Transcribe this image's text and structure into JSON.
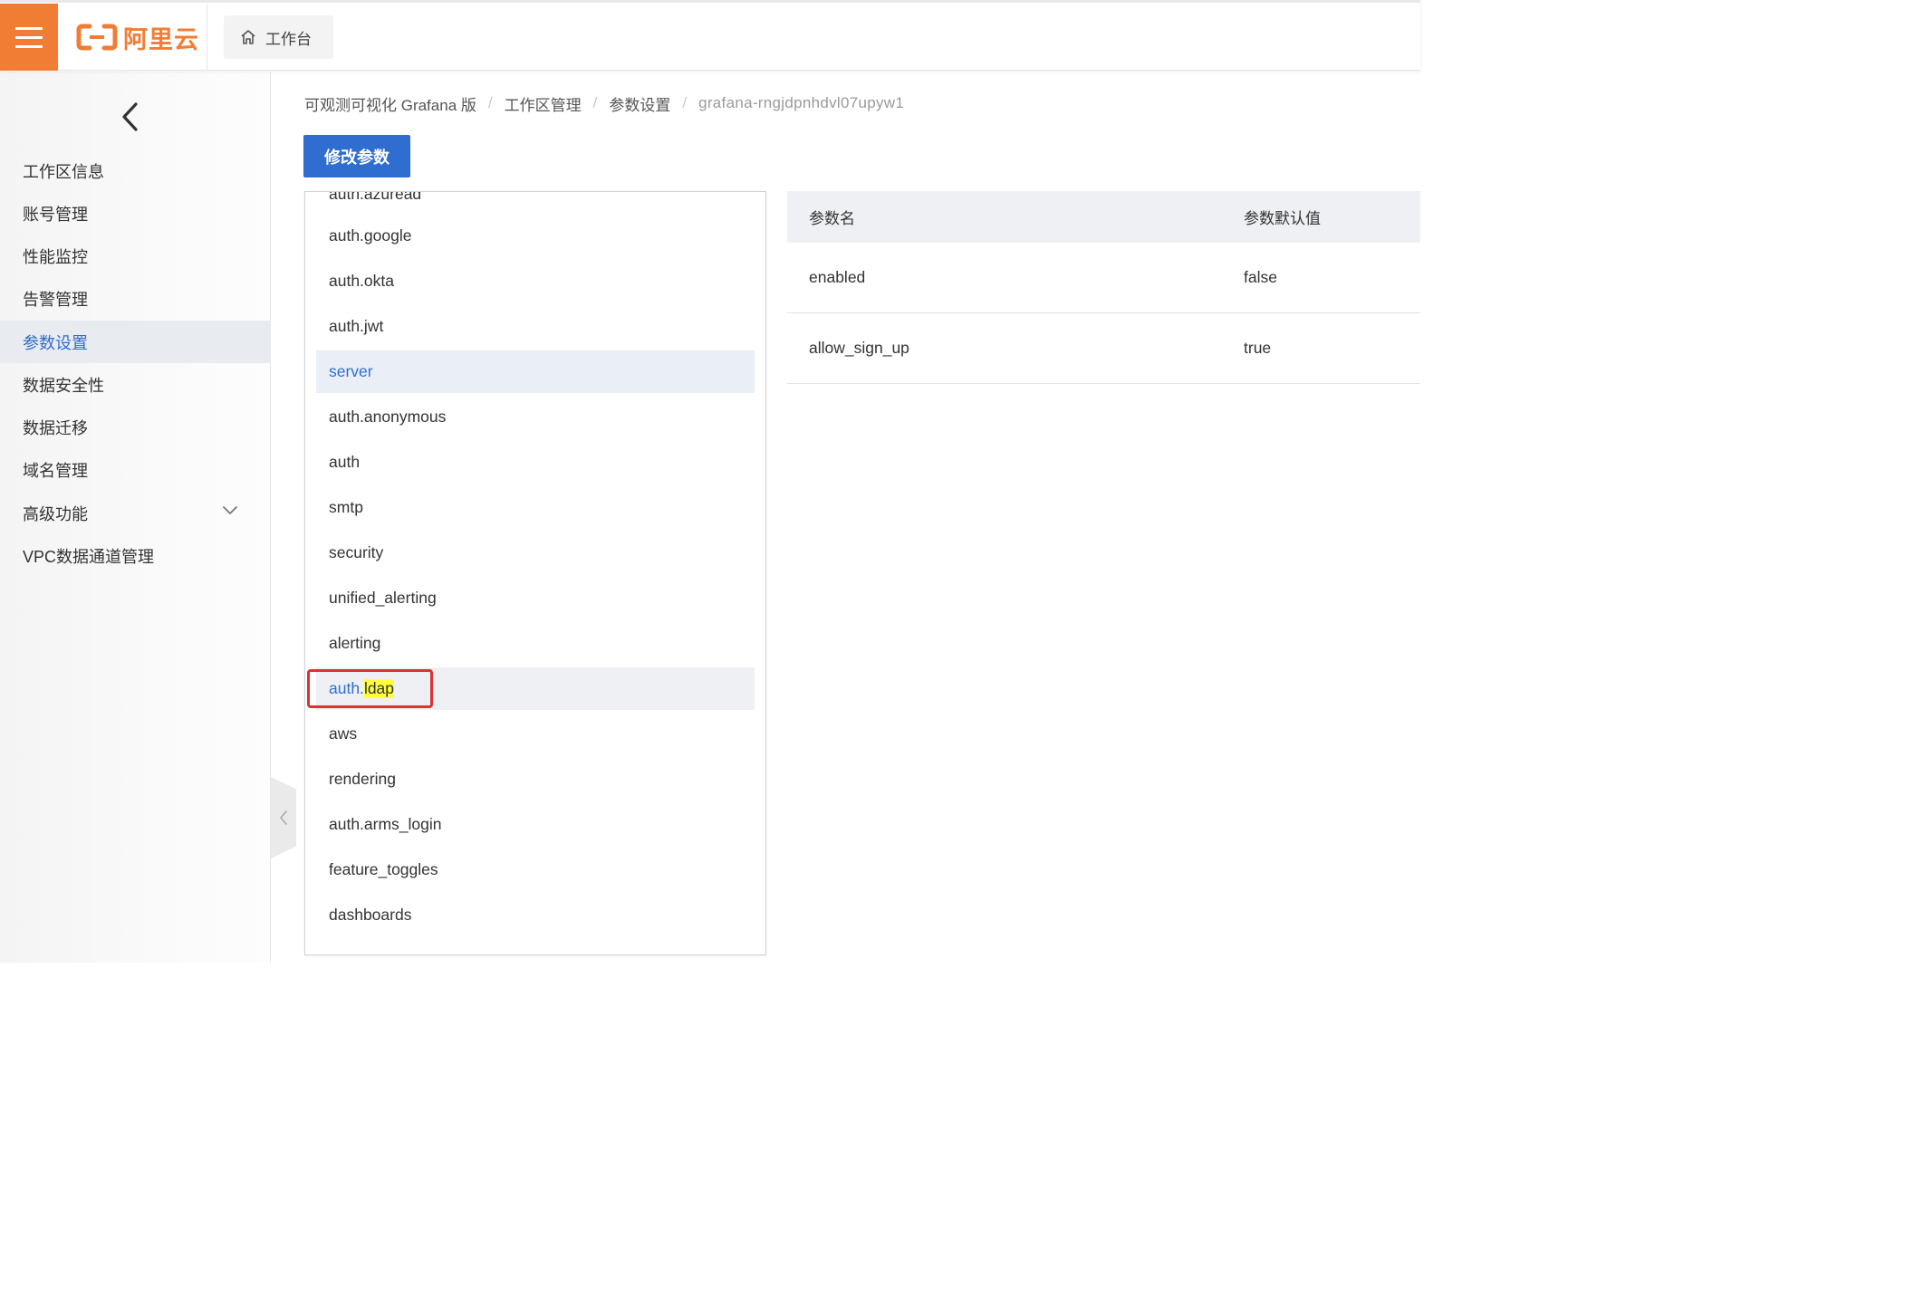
{
  "header": {
    "logo_text": "阿里云",
    "brand_color": "#f17d35",
    "workbench_label": "工作台"
  },
  "sidebar": {
    "items": [
      {
        "label": "工作区信息"
      },
      {
        "label": "账号管理"
      },
      {
        "label": "性能监控"
      },
      {
        "label": "告警管理"
      },
      {
        "label": "参数设置",
        "active": true
      },
      {
        "label": "数据安全性"
      },
      {
        "label": "数据迁移"
      },
      {
        "label": "域名管理"
      },
      {
        "label": "高级功能",
        "expandable": true
      },
      {
        "label": "VPC数据通道管理"
      }
    ]
  },
  "breadcrumb": {
    "items": [
      "可观测可视化 Grafana 版",
      "工作区管理",
      "参数设置",
      "grafana-rngjdpnhdvl07upyw1"
    ],
    "separator": "/"
  },
  "actions": {
    "modify_label": "修改参数",
    "accent": "#2f6dd0"
  },
  "dropdown": {
    "partial_top": "auth.azuread",
    "items": [
      {
        "label": "auth.google"
      },
      {
        "label": "auth.okta"
      },
      {
        "label": "auth.jwt"
      },
      {
        "label": "server",
        "selected": true
      },
      {
        "label": "auth.anonymous"
      },
      {
        "label": "auth"
      },
      {
        "label": "smtp"
      },
      {
        "label": "security"
      },
      {
        "label": "unified_alerting"
      },
      {
        "label": "alerting"
      },
      {
        "label": "auth.ldap",
        "hovered": true,
        "prefix": "auth.",
        "highlight": "ldap",
        "annotated": true
      },
      {
        "label": "aws"
      },
      {
        "label": "rendering"
      },
      {
        "label": "auth.arms_login"
      },
      {
        "label": "feature_toggles"
      },
      {
        "label": "dashboards"
      }
    ]
  },
  "table": {
    "headers": [
      "参数名",
      "参数默认值"
    ],
    "rows": [
      [
        "enabled",
        "false"
      ],
      [
        "allow_sign_up",
        "true"
      ]
    ]
  },
  "icons": {
    "menu": "hamburger-icon",
    "home": "home-icon",
    "collapse": "chevron-left-icon",
    "expand": "chevron-down-icon"
  }
}
